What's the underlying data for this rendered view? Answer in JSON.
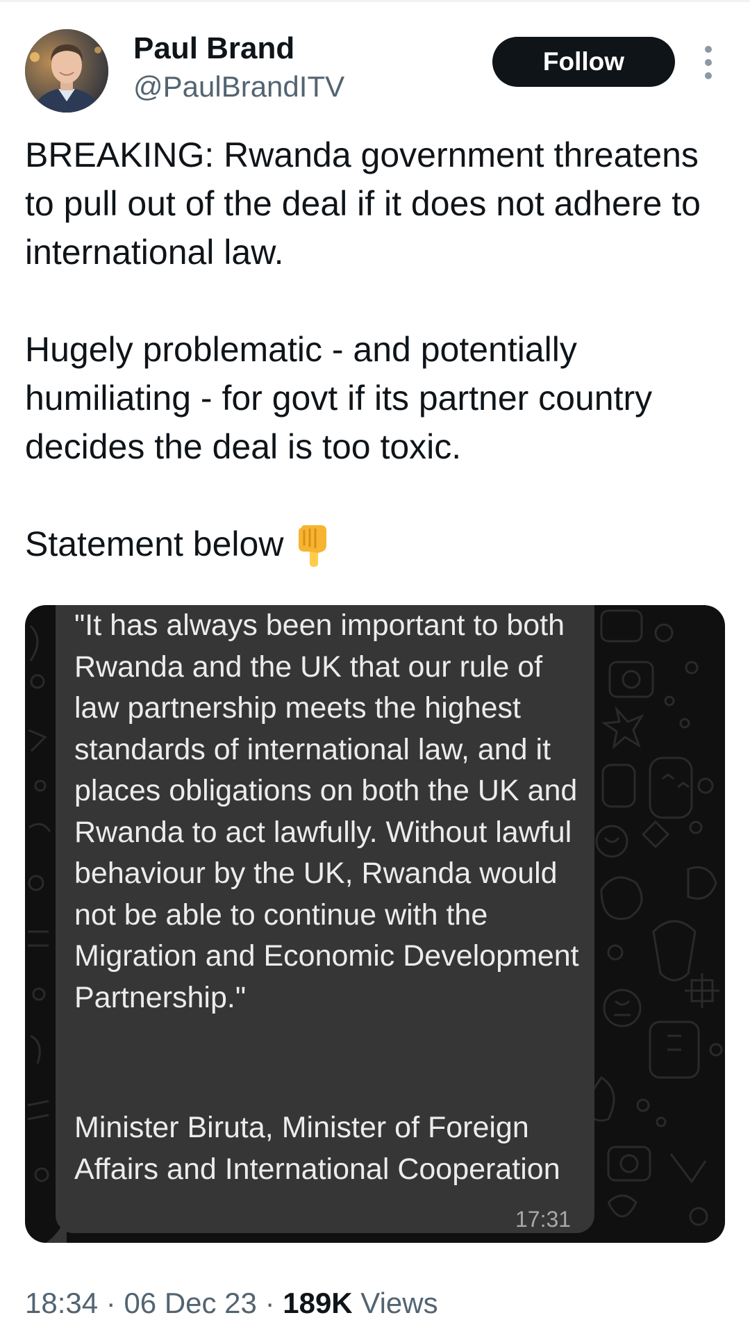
{
  "author": {
    "name": "Paul Brand",
    "handle": "@PaulBrandITV"
  },
  "follow_label": "Follow",
  "tweet": {
    "paragraphs": [
      "BREAKING: Rwanda government threatens to pull out of the deal if it does not adhere to international law.",
      "Hugely problematic - and potentially humiliating - for govt if its partner country decides the deal is too toxic.",
      "Statement below"
    ],
    "emoji": "backhand-index-pointing-down-icon"
  },
  "media": {
    "quote": "\"It has always been important to both Rwanda and the UK that our rule of law partnership meets the highest standards of international law, and it places obligations on both the UK and Rwanda to act lawfully. Without lawful behaviour by the UK, Rwanda would not be able to continue with the Migration and Economic Development Partnership.\"",
    "attribution": "Minister Biruta, Minister of Foreign Affairs and International Cooperation",
    "time": "17:31"
  },
  "meta": {
    "time": "18:34",
    "separator": " · ",
    "date": "06 Dec 23",
    "views_count": "189K",
    "views_label": " Views"
  },
  "colors": {
    "follow_bg": "#0f1419",
    "secondary_text": "#536471",
    "bubble_bg": "#363636",
    "media_bg": "#101010"
  }
}
